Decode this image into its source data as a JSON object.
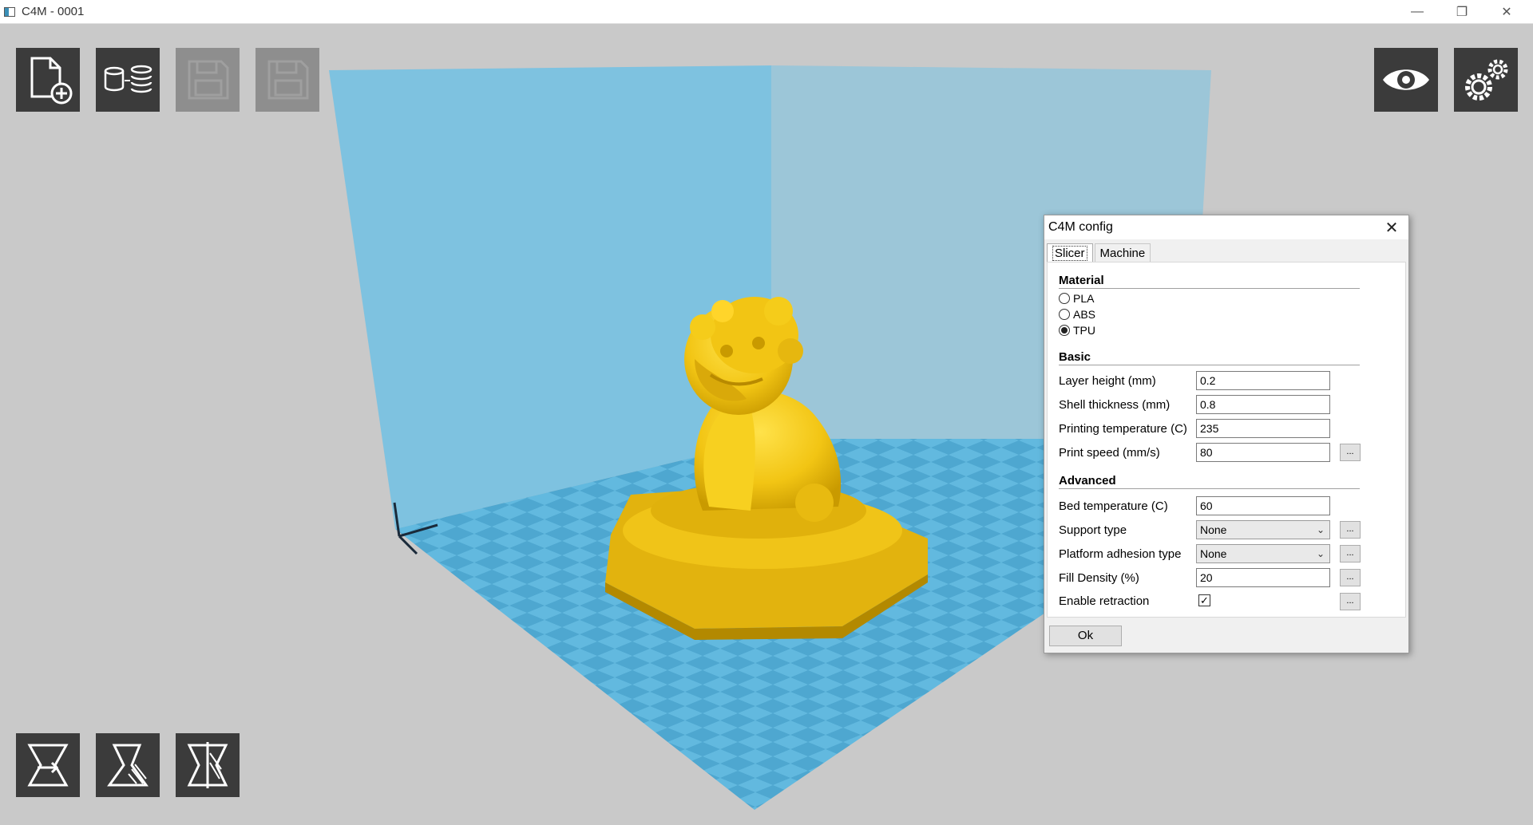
{
  "window": {
    "title": "C4M - 0001",
    "minimize": "—",
    "restore": "❐",
    "close": "✕"
  },
  "toolbar": {
    "top_left": [
      {
        "name": "add-file-button",
        "icon": "add-file-icon",
        "enabled": true
      },
      {
        "name": "database-button",
        "icon": "database-stack-icon",
        "enabled": true
      },
      {
        "name": "save-button",
        "icon": "floppy-disk-icon",
        "enabled": false
      },
      {
        "name": "save-as-button",
        "icon": "floppy-disk-icon",
        "enabled": false
      }
    ],
    "top_right": [
      {
        "name": "preview-button",
        "icon": "eye-icon"
      },
      {
        "name": "settings-button",
        "icon": "gears-icon"
      }
    ],
    "bottom_left": [
      {
        "name": "move-tool-button",
        "icon": "move-icon"
      },
      {
        "name": "scale-tool-button",
        "icon": "scale-icon"
      },
      {
        "name": "mirror-tool-button",
        "icon": "mirror-icon"
      }
    ]
  },
  "scene": {
    "build_plate_color": "#5fb8de",
    "wall_color": "#7ec2e0",
    "model_color": "#f2c514"
  },
  "dialog": {
    "title": "C4M config",
    "close": "✕",
    "tabs": [
      {
        "label": "Slicer",
        "active": true
      },
      {
        "label": "Machine",
        "active": false
      }
    ],
    "material": {
      "heading": "Material",
      "options": [
        {
          "label": "PLA",
          "selected": false
        },
        {
          "label": "ABS",
          "selected": false
        },
        {
          "label": "TPU",
          "selected": true
        }
      ]
    },
    "basic": {
      "heading": "Basic",
      "layer_height": {
        "label": "Layer height (mm)",
        "value": "0.2"
      },
      "shell_thickness": {
        "label": "Shell thickness (mm)",
        "value": "0.8"
      },
      "print_temp": {
        "label": "Printing temperature (C)",
        "value": "235"
      },
      "print_speed": {
        "label": "Print speed (mm/s)",
        "value": "80",
        "more": "..."
      }
    },
    "advanced": {
      "heading": "Advanced",
      "bed_temp": {
        "label": "Bed temperature (C)",
        "value": "60"
      },
      "support_type": {
        "label": "Support type",
        "value": "None",
        "more": "..."
      },
      "adhesion_type": {
        "label": "Platform adhesion type",
        "value": "None",
        "more": "..."
      },
      "fill_density": {
        "label": "Fill Density (%)",
        "value": "20",
        "more": "..."
      },
      "retraction": {
        "label": "Enable retraction",
        "checked": true,
        "mark": "✓",
        "more": "..."
      }
    },
    "ok_label": "Ok"
  }
}
